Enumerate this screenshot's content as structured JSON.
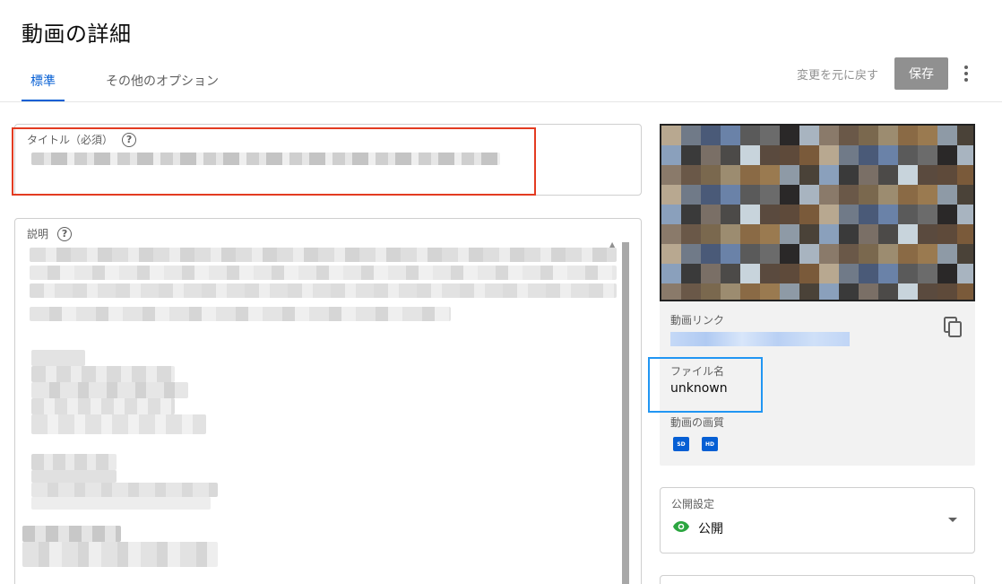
{
  "header": {
    "page_title": "動画の詳細",
    "tabs": [
      {
        "label": "標準"
      },
      {
        "label": "その他のオプション"
      }
    ],
    "undo_label": "変更を元に戻す",
    "save_label": "保存"
  },
  "title_field": {
    "label": "タイトル（必須）",
    "help": "?"
  },
  "description_field": {
    "label": "説明",
    "help": "?"
  },
  "side": {
    "video_link_label": "動画リンク",
    "file_name_label": "ファイル名",
    "file_name": "unknown",
    "quality_label": "動画の画質",
    "quality_badges": [
      "SD",
      "HD"
    ]
  },
  "visibility": {
    "label": "公開設定",
    "value": "公開"
  },
  "colors": {
    "accent": "#065fd4",
    "highlight_red": "#e33b21",
    "highlight_blue": "#2196f3",
    "public_green": "#2ba640"
  },
  "icons": [
    "help-icon",
    "copy-icon",
    "eye-icon",
    "dropdown-arrow-icon",
    "more-vert-icon"
  ]
}
